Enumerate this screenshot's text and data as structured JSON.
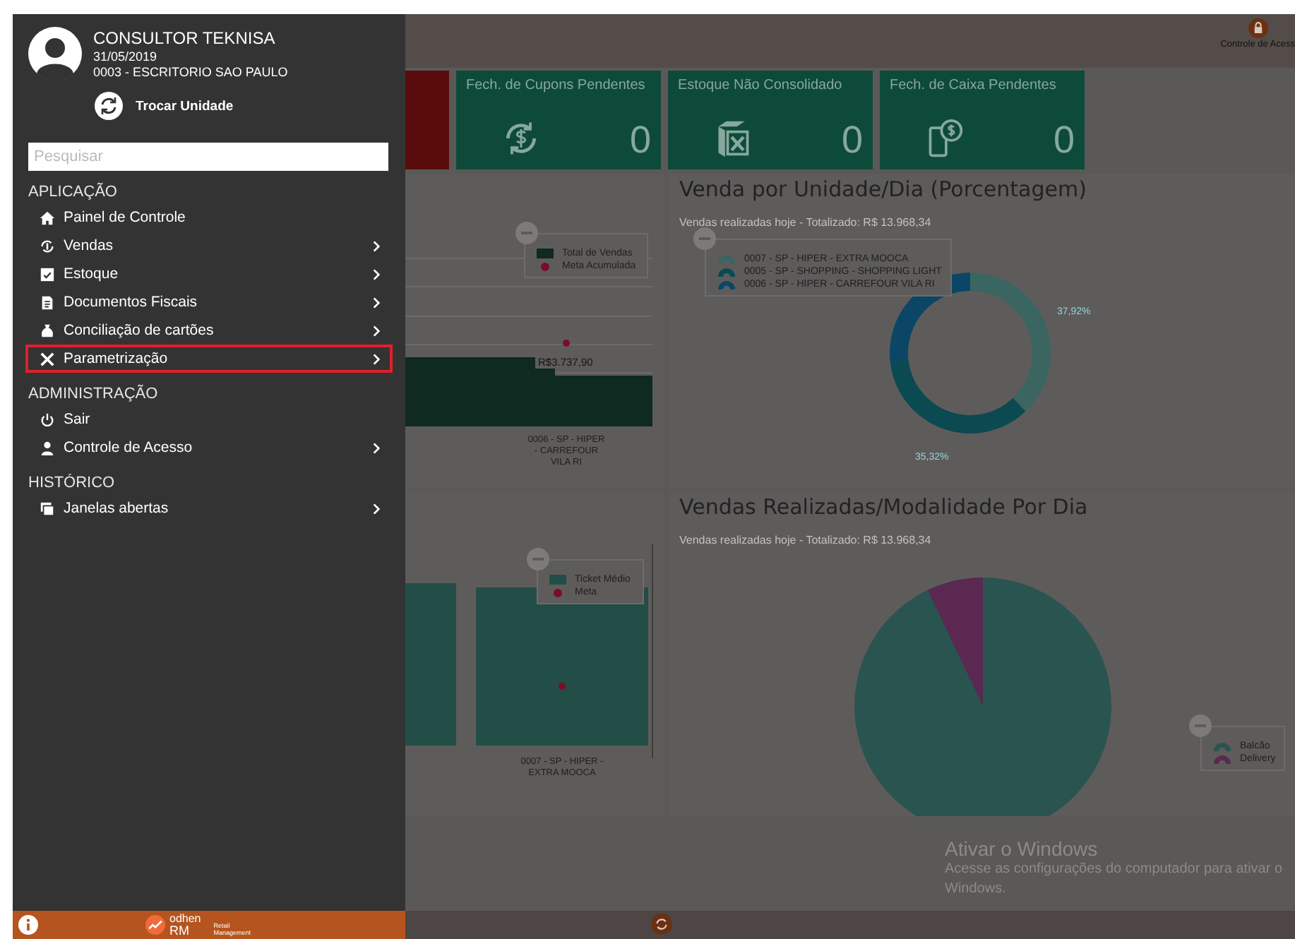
{
  "sidebar": {
    "user": {
      "name": "CONSULTOR TEKNISA",
      "date": "31/05/2019",
      "unit": "0003 - ESCRITORIO SAO PAULO"
    },
    "switch_unit": "Trocar Unidade",
    "search": {
      "placeholder": "Pesquisar"
    },
    "sections": [
      {
        "title": "APLICAÇÃO",
        "items": [
          {
            "label": "Painel de Controle",
            "kind": "home",
            "has_submenu": false,
            "selected": false
          },
          {
            "label": "Vendas",
            "kind": "cycle",
            "has_submenu": true,
            "selected": false
          },
          {
            "label": "Estoque",
            "kind": "box",
            "has_submenu": true,
            "selected": false
          },
          {
            "label": "Documentos Fiscais",
            "kind": "doc",
            "has_submenu": true,
            "selected": false
          },
          {
            "label": "Conciliação de cartões",
            "kind": "bag",
            "has_submenu": true,
            "selected": false
          },
          {
            "label": "Parametrização",
            "kind": "tools",
            "has_submenu": true,
            "selected": true
          }
        ]
      },
      {
        "title": "ADMINISTRAÇÃO",
        "items": [
          {
            "label": "Sair",
            "kind": "power",
            "has_submenu": false,
            "selected": false
          },
          {
            "label": "Controle de Acesso",
            "kind": "user",
            "has_submenu": true,
            "selected": false
          }
        ]
      },
      {
        "title": "HISTÓRICO",
        "items": [
          {
            "label": "Janelas abertas",
            "kind": "windows",
            "has_submenu": true,
            "selected": false
          }
        ]
      }
    ],
    "footer": {
      "brand": "odhen",
      "brand_sub": "RM",
      "tagline": "Retail Management"
    }
  },
  "top_bar": {
    "action": "Controle de Acess"
  },
  "cards": [
    {
      "kind": "alert",
      "color": "#5a0c0c"
    },
    {
      "kind": "coupons",
      "color": "#0e4a39",
      "title": "Fech. de Cupons Pendentes",
      "value": "0"
    },
    {
      "kind": "stock",
      "color": "#0e4a39",
      "title": "Estoque Não Consolidado",
      "value": "0"
    },
    {
      "kind": "cashier",
      "color": "#0e4a39",
      "title": "Fech. de Caixa Pendentes",
      "value": "0"
    }
  ],
  "sales_bar_panel": {
    "legend": [
      {
        "label": "Total de Vendas",
        "kind": "bar",
        "color": "#0f2a20"
      },
      {
        "label": "Meta Acumulada",
        "kind": "dot",
        "color": "#7a0d2a"
      }
    ],
    "value_label": "R$3.737,90",
    "x_label": "0006 - SP - HIPER - CARREFOUR VILA RI"
  },
  "donut_panel": {
    "title": "Venda por Unidade/Dia (Porcentagem)",
    "subtitle": "Vendas realizadas hoje - Totalizado: R$ 13.968,34",
    "chart_data": {
      "type": "donut",
      "categories": [
        "0007 - SP - HIPER - EXTRA MOOCA",
        "0005 - SP - SHOPPING - SHOPPING LIGHT",
        "0006 - SP - HIPER - CARREFOUR VILA RI"
      ],
      "values": [
        37.92,
        35.32,
        26.76
      ],
      "colors": [
        "#3b6560",
        "#0a4a50",
        "#0b4667"
      ],
      "value_labels": [
        "37,92%",
        "35,32%",
        null
      ]
    }
  },
  "ticket_panel": {
    "legend": [
      {
        "label": "Ticket Médio",
        "kind": "bar",
        "color": "#234d47"
      },
      {
        "label": "Meta",
        "kind": "dot",
        "color": "#7a0d2a"
      }
    ],
    "x_label": "0007 - SP - HIPER - EXTRA MOOCA"
  },
  "pie_panel": {
    "title": "Vendas Realizadas/Modalidade Por Dia",
    "subtitle": "Vendas realizadas hoje - Totalizado: R$ 13.968,34",
    "legend": [
      {
        "label": "Balcão",
        "color": "#2a5450"
      },
      {
        "label": "Delivery",
        "color": "#5a2850"
      }
    ]
  },
  "windows_notice": {
    "title": "Ativar o Windows",
    "text": "Acesse as configurações do computador para ativar o Windows."
  }
}
